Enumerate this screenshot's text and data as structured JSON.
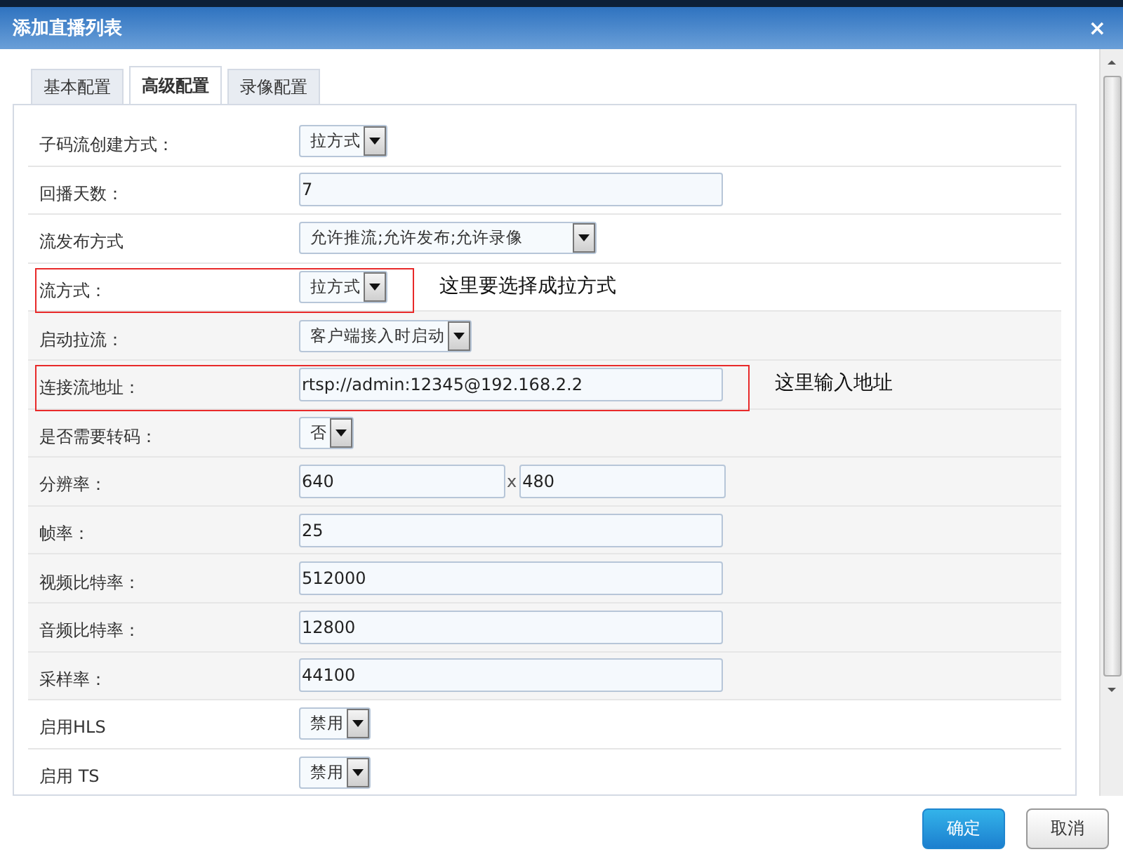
{
  "window": {
    "title": "添加直播列表",
    "close": "×"
  },
  "tabs": [
    {
      "label": "基本配置",
      "selected": false
    },
    {
      "label": "高级配置",
      "selected": true
    },
    {
      "label": "录像配置",
      "selected": false
    }
  ],
  "rows": [
    {
      "label": "子码流创建方式：",
      "kind": "select",
      "value": "拉方式"
    },
    {
      "label": "回播天数：",
      "kind": "text",
      "value": "7"
    },
    {
      "label": "流发布方式",
      "kind": "select",
      "value": "允许推流;允许发布;允许录像",
      "wide": true
    },
    {
      "label": "流方式：",
      "kind": "select",
      "value": "拉方式",
      "annotation": "这里要选择成拉方式"
    },
    {
      "label": "启动拉流：",
      "kind": "select",
      "value": "客户端接入时启动"
    },
    {
      "label": "连接流地址：",
      "kind": "text",
      "value": "rtsp://admin:12345@192.168.2.2",
      "annotation": "这里输入地址"
    },
    {
      "label": "是否需要转码：",
      "kind": "select",
      "value": "否"
    },
    {
      "label": "分辨率：",
      "kind": "pair",
      "values": [
        "640",
        "480"
      ],
      "separator": "x"
    },
    {
      "label": "帧率：",
      "kind": "text",
      "value": "25"
    },
    {
      "label": "视频比特率：",
      "kind": "text",
      "value": "512000"
    },
    {
      "label": "音频比特率：",
      "kind": "text",
      "value": "12800"
    },
    {
      "label": "采样率：",
      "kind": "text",
      "value": "44100"
    },
    {
      "label": "启用HLS",
      "kind": "select",
      "value": "禁用"
    },
    {
      "label": "启用 TS",
      "kind": "select",
      "value": "禁用"
    }
  ],
  "buttons": [
    {
      "label": "确定",
      "kind": "primary"
    },
    {
      "label": "取消",
      "kind": "secondary"
    }
  ]
}
